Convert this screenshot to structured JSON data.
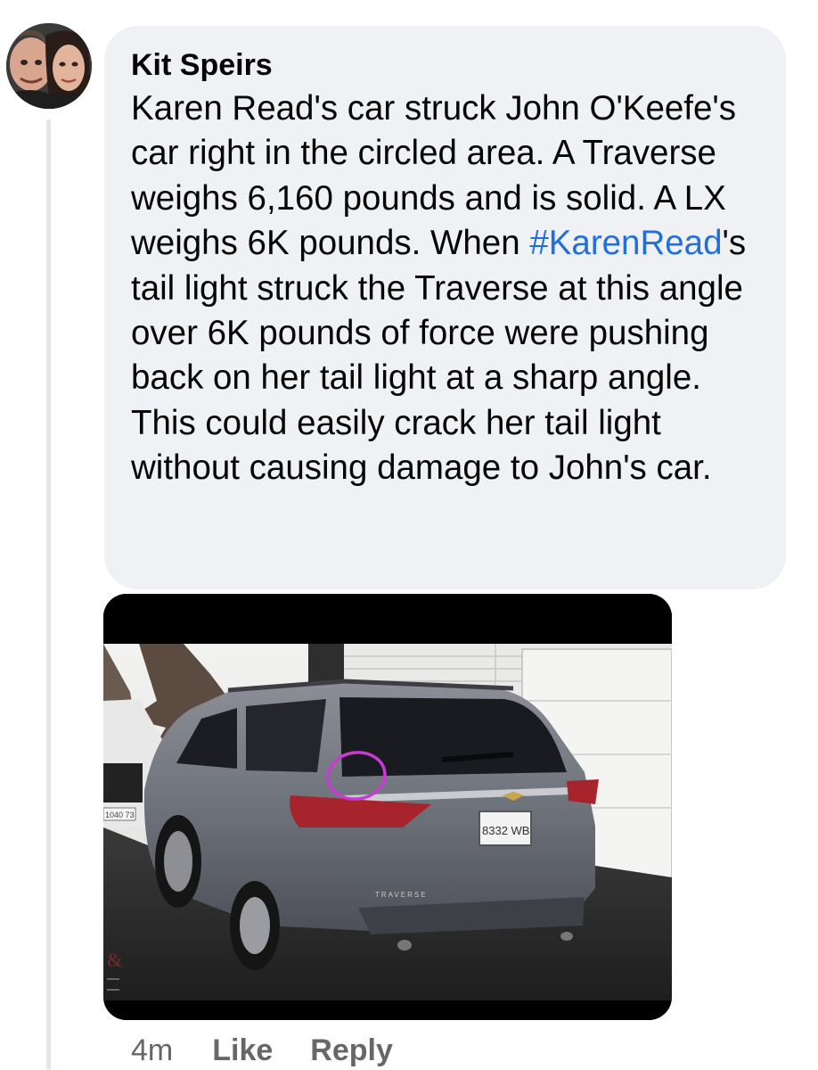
{
  "comment": {
    "author": "Kit Speirs",
    "text_before_hashtag": "Karen Read's car struck John O'Keefe's car right in the circled area. A Traverse weighs 6,160 pounds and is solid. A LX weighs 6K pounds. When ",
    "hashtag": "#KarenRead",
    "text_after_hashtag": "'s tail light struck the Traverse at this angle over 6K pounds of force were pushing back on her tail light at a sharp angle. This could easily crack her tail light without causing damage to John's car.",
    "timestamp": "4m",
    "like_label": "Like",
    "reply_label": "Reply"
  },
  "photo": {
    "license_plate": "8332 WB",
    "other_plate": "1040 73",
    "vehicle_badge": "TRAVERSE",
    "watermark": "&"
  },
  "colors": {
    "hashtag": "#216fdb",
    "bubble_background": "#f0f1f5",
    "meta_text": "#65676b",
    "circle_annotation": "#c83ad0"
  }
}
